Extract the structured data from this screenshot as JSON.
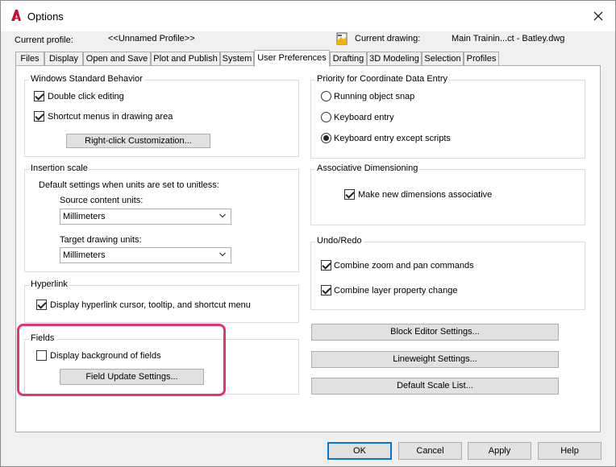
{
  "window": {
    "title": "Options"
  },
  "profile": {
    "current_profile_label": "Current profile:",
    "current_profile_value": "<<Unnamed Profile>>",
    "current_drawing_label": "Current drawing:",
    "current_drawing_value": "Main Trainin...ct - Batley.dwg"
  },
  "tabs": [
    {
      "label": "Files"
    },
    {
      "label": "Display"
    },
    {
      "label": "Open and Save"
    },
    {
      "label": "Plot and Publish"
    },
    {
      "label": "System"
    },
    {
      "label": "User Preferences",
      "active": true
    },
    {
      "label": "Drafting"
    },
    {
      "label": "3D Modeling"
    },
    {
      "label": "Selection"
    },
    {
      "label": "Profiles"
    }
  ],
  "windows_behavior": {
    "title": "Windows Standard Behavior",
    "double_click_editing": {
      "label": "Double click editing",
      "checked": true
    },
    "shortcut_menus": {
      "label": "Shortcut menus in drawing area",
      "checked": true
    },
    "right_click_button": "Right-click Customization..."
  },
  "insertion_scale": {
    "title": "Insertion scale",
    "description": "Default settings when units are set to unitless:",
    "source_label": "Source content units:",
    "source_value": "Millimeters",
    "target_label": "Target drawing units:",
    "target_value": "Millimeters"
  },
  "hyperlink": {
    "title": "Hyperlink",
    "display_cursor": {
      "label": "Display hyperlink cursor, tooltip, and shortcut menu",
      "checked": true
    }
  },
  "fields": {
    "title": "Fields",
    "display_background": {
      "label": "Display background of fields",
      "checked": false
    },
    "update_button": "Field Update Settings..."
  },
  "coordinate_priority": {
    "title": "Priority for Coordinate Data Entry",
    "options": [
      {
        "label": "Running object snap",
        "selected": false
      },
      {
        "label": "Keyboard entry",
        "selected": false
      },
      {
        "label": "Keyboard entry except scripts",
        "selected": true
      }
    ]
  },
  "associative_dim": {
    "title": "Associative Dimensioning",
    "make_associative": {
      "label": "Make new dimensions associative",
      "checked": true
    }
  },
  "undo_redo": {
    "title": "Undo/Redo",
    "combine_zoom": {
      "label": "Combine zoom and pan commands",
      "checked": true
    },
    "combine_layer": {
      "label": "Combine layer property change",
      "checked": true
    }
  },
  "right_buttons": {
    "block_editor": "Block Editor Settings...",
    "lineweight": "Lineweight Settings...",
    "default_scale": "Default Scale List..."
  },
  "footer": {
    "ok": "OK",
    "cancel": "Cancel",
    "apply": "Apply",
    "help": "Help"
  },
  "colors": {
    "highlight": "#e6336b",
    "app_icon": "#c8102e",
    "default_button_border": "#0078d7"
  }
}
